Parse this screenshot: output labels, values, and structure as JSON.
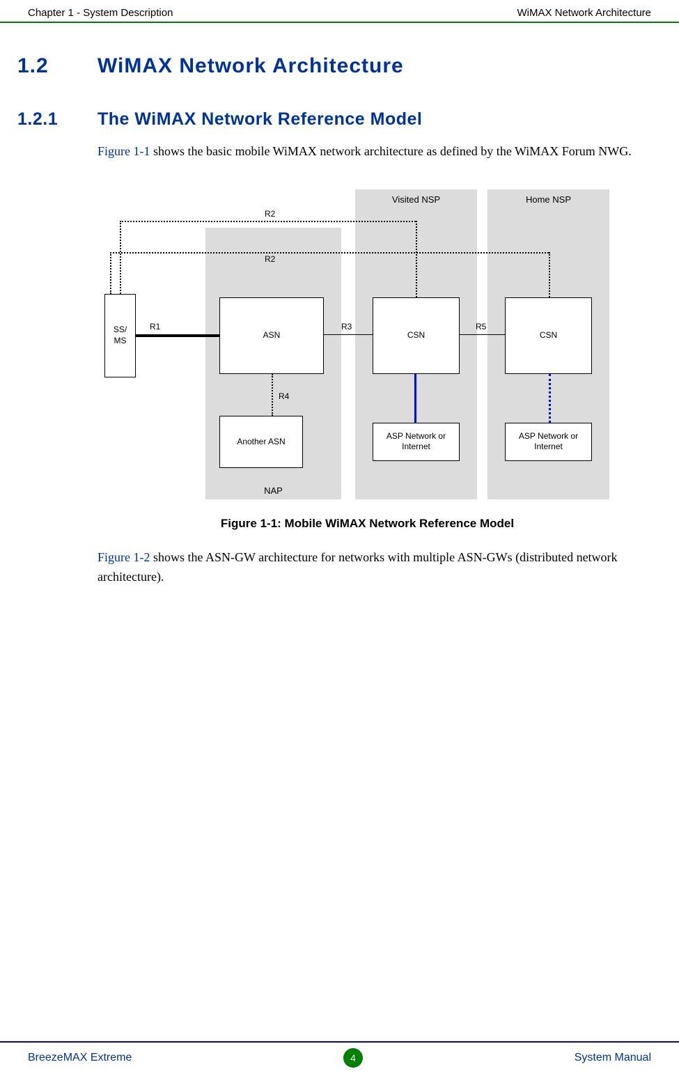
{
  "header": {
    "left": "Chapter 1 - System Description",
    "right": "WiMAX Network Architecture"
  },
  "section": {
    "number": "1.2",
    "title": "WiMAX Network Architecture"
  },
  "subsection": {
    "number": "1.2.1",
    "title": "The WiMAX Network Reference Model"
  },
  "para1": {
    "link": "Figure 1-1",
    "rest": " shows the basic mobile WiMAX network architecture as defined by the WiMAX Forum NWG."
  },
  "figure": {
    "caption": "Figure 1-1: Mobile WiMAX Network Reference Model",
    "labels": {
      "visited_nsp": "Visited NSP",
      "home_nsp": "Home NSP",
      "nap": "NAP",
      "ss_ms": "SS/\nMS",
      "asn": "ASN",
      "csn1": "CSN",
      "csn2": "CSN",
      "another_asn": "Another ASN",
      "asp1": "ASP Network or Internet",
      "asp2": "ASP Network  or Internet",
      "r1": "R1",
      "r2a": "R2",
      "r2b": "R2",
      "r3": "R3",
      "r4": "R4",
      "r5": "R5"
    }
  },
  "para2": {
    "link": "Figure 1-2",
    "rest": " shows the ASN-GW architecture for networks with multiple ASN-GWs (distributed network architecture)."
  },
  "footer": {
    "left": "BreezeMAX Extreme",
    "page": "4",
    "right": "System Manual"
  }
}
